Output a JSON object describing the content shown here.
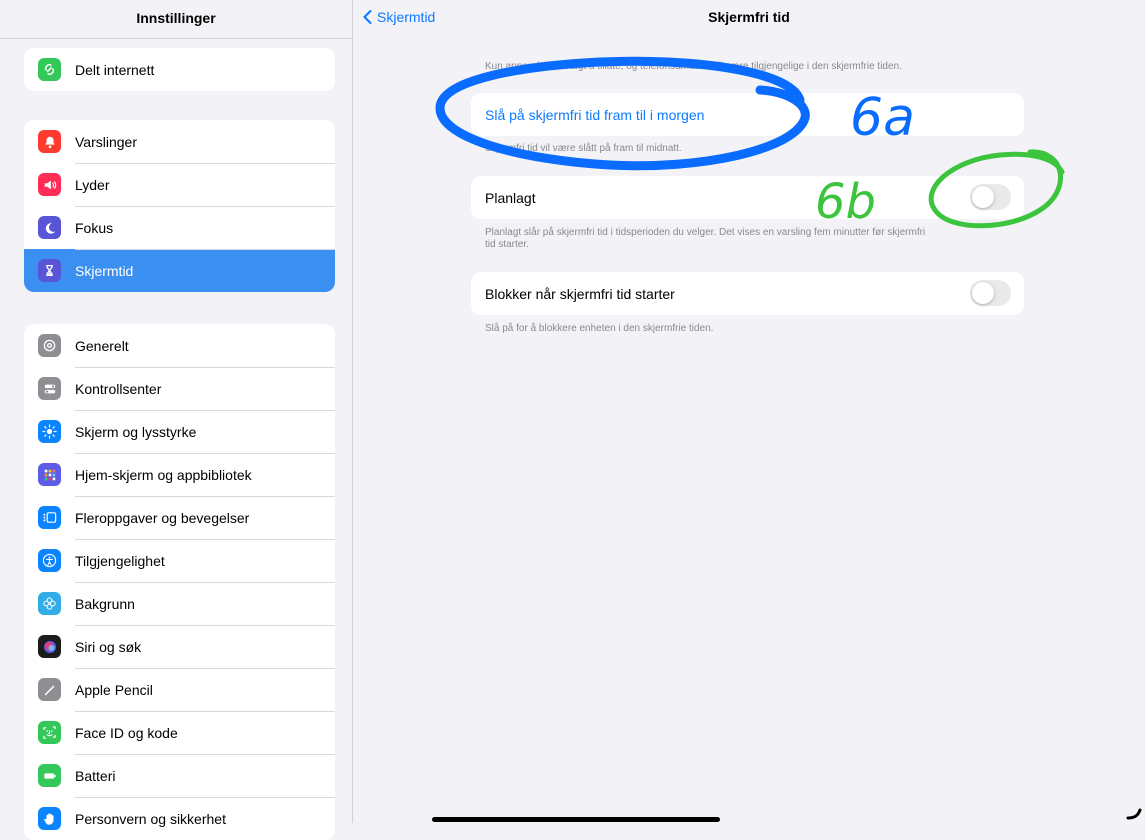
{
  "sidebar": {
    "title": "Innstillinger",
    "group1": [
      {
        "label": "Delt internett",
        "icon": "personal-hotspot-icon",
        "color": "#34c759"
      }
    ],
    "group2": [
      {
        "label": "Varslinger",
        "icon": "notifications-icon",
        "color": "#ff3b30"
      },
      {
        "label": "Lyder",
        "icon": "sounds-icon",
        "color": "#ff2d55"
      },
      {
        "label": "Fokus",
        "icon": "moon-icon",
        "color": "#5856d6"
      },
      {
        "label": "Skjermtid",
        "icon": "hourglass-icon",
        "color": "#5856d6",
        "selected": true
      }
    ],
    "group3": [
      {
        "label": "Generelt",
        "icon": "gear-icon",
        "color": "#8e8e93"
      },
      {
        "label": "Kontrollsenter",
        "icon": "control-center-icon",
        "color": "#8e8e93"
      },
      {
        "label": "Skjerm og lysstyrke",
        "icon": "brightness-icon",
        "color": "#0a84ff"
      },
      {
        "label": "Hjem-skjerm og appbibliotek",
        "icon": "home-screen-icon",
        "color": "#5e5ce6"
      },
      {
        "label": "Fleroppgaver og bevegelser",
        "icon": "multitasking-icon",
        "color": "#0a84ff"
      },
      {
        "label": "Tilgjengelighet",
        "icon": "accessibility-icon",
        "color": "#0a84ff"
      },
      {
        "label": "Bakgrunn",
        "icon": "wallpaper-icon",
        "color": "#32ade6"
      },
      {
        "label": "Siri og søk",
        "icon": "siri-icon",
        "color": "#1c1c1e"
      },
      {
        "label": "Apple Pencil",
        "icon": "pencil-icon",
        "color": "#8e8e93"
      },
      {
        "label": "Face ID og kode",
        "icon": "face-id-icon",
        "color": "#34c759"
      },
      {
        "label": "Batteri",
        "icon": "battery-icon",
        "color": "#34c759"
      },
      {
        "label": "Personvern og sikkerhet",
        "icon": "privacy-hand-icon",
        "color": "#0a84ff"
      }
    ]
  },
  "main": {
    "back_label": "Skjermtid",
    "title": "Skjermfri tid",
    "intro_note": "Kun apper du har valgt å tillate, og telefonsamtaler, vil være tilgjengelige i den skjermfrie tiden.",
    "turn_on_label": "Slå på skjermfri tid fram til i morgen",
    "turn_on_note": "Skjermfri tid vil være slått på fram til midnatt.",
    "scheduled_label": "Planlagt",
    "scheduled_on": false,
    "scheduled_note_line1": "Planlagt slår på skjermfri tid i tidsperioden du velger. Det vises en varsling fem minutter før skjermfri",
    "scheduled_note_line2": "tid starter.",
    "block_label": "Blokker når skjermfri tid starter",
    "block_on": false,
    "block_note": "Slå på for å blokkere enheten i den skjermfrie tiden."
  },
  "annotations": {
    "label_a": "6a",
    "label_b": "6b",
    "color_blue": "#0a6cff",
    "color_green": "#3cc43c"
  }
}
